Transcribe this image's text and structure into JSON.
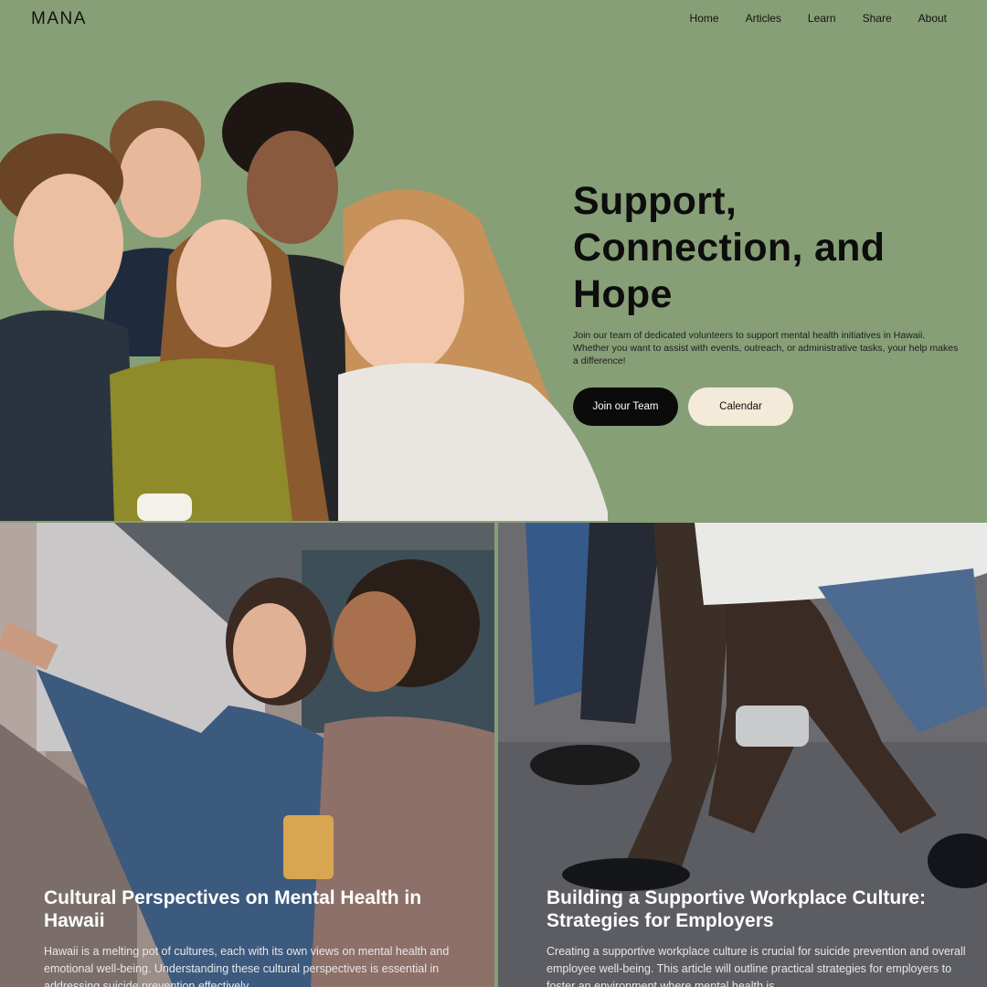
{
  "brand": {
    "logo": "MANA"
  },
  "nav": {
    "items": [
      "Home",
      "Articles",
      "Learn",
      "Share",
      "About"
    ]
  },
  "hero": {
    "title": "Support, Connection, and Hope",
    "description": "Join our team of dedicated volunteers to support mental health initiatives in Hawaii. Whether you want to assist with events, outreach, or administrative tasks, your help makes a difference!",
    "primary_button": "Join our Team",
    "secondary_button": "Calendar",
    "image_label": "group-of-teens-selfie-photo"
  },
  "articles": [
    {
      "title": "Cultural Perspectives on Mental Health in Hawaii",
      "excerpt": "Hawaii is a melting pot of cultures, each with its own views on mental health and emotional well-being. Understanding these cultural perspectives is essential in addressing suicide prevention effectively."
    },
    {
      "title": "Building a Supportive Workplace Culture: Strategies for Employers",
      "excerpt": "Creating a supportive workplace culture is crucial for suicide prevention and overall employee well-being. This article will outline practical strategies for employers to foster an environment where mental health is"
    }
  ],
  "colors": {
    "hero_bg": "#879f76",
    "dark_button": "#0b0b0b",
    "light_button": "#f3ead9"
  }
}
